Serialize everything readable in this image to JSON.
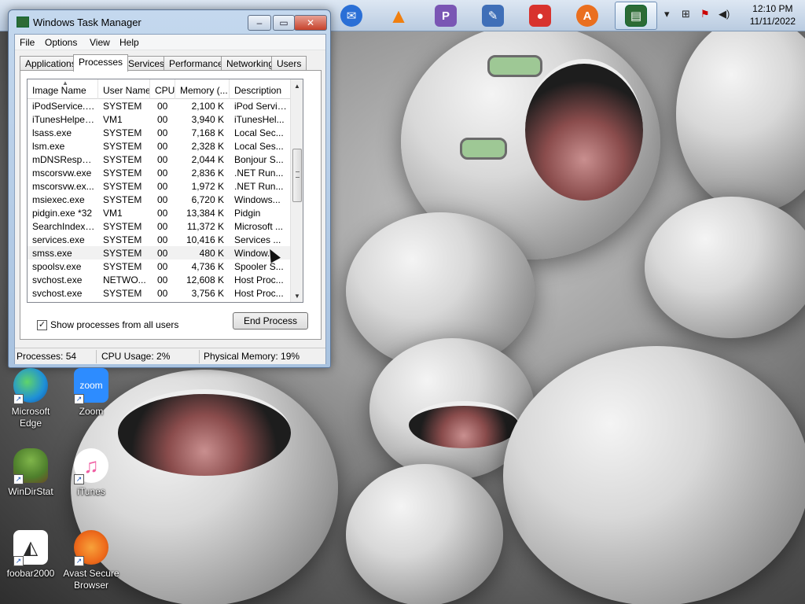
{
  "taskbar": {
    "pinned": [
      {
        "name": "thunderbird-icon",
        "color": "#2a6fd6"
      },
      {
        "name": "vlc-icon",
        "color": "#f07f0f"
      },
      {
        "name": "pidgin-icon",
        "color": "#7a56b4"
      },
      {
        "name": "paint-icon",
        "color": "#3f6fb8"
      },
      {
        "name": "recorder-icon",
        "color": "#d8332e"
      },
      {
        "name": "avast-browser-icon",
        "color": "#ea6f1f"
      },
      {
        "name": "task-manager-icon",
        "color": "#2d6b35"
      }
    ],
    "clock": {
      "time": "12:10 PM",
      "date": "11/11/2022"
    }
  },
  "window": {
    "title": "Windows Task Manager",
    "buttons": {
      "minimize": "–",
      "maximize": "▭",
      "close": "✕"
    },
    "menu": [
      "File",
      "Options",
      "View",
      "Help"
    ],
    "tabs": [
      "Applications",
      "Processes",
      "Services",
      "Performance",
      "Networking",
      "Users"
    ],
    "active_tab": "Processes",
    "columns": [
      "Image Name",
      "User Name",
      "CPU",
      "Memory (...",
      "Description"
    ],
    "processes": [
      {
        "name": "iPodService.exe",
        "user": "SYSTEM",
        "cpu": "00",
        "mem": "2,100 K",
        "desc": "iPod Service"
      },
      {
        "name": "iTunesHelper....",
        "user": "VM1",
        "cpu": "00",
        "mem": "3,940 K",
        "desc": "iTunesHel..."
      },
      {
        "name": "lsass.exe",
        "user": "SYSTEM",
        "cpu": "00",
        "mem": "7,168 K",
        "desc": "Local Sec..."
      },
      {
        "name": "lsm.exe",
        "user": "SYSTEM",
        "cpu": "00",
        "mem": "2,328 K",
        "desc": "Local Ses..."
      },
      {
        "name": "mDNSRespon...",
        "user": "SYSTEM",
        "cpu": "00",
        "mem": "2,044 K",
        "desc": "Bonjour S..."
      },
      {
        "name": "mscorsvw.exe",
        "user": "SYSTEM",
        "cpu": "00",
        "mem": "2,836 K",
        "desc": ".NET Run..."
      },
      {
        "name": "mscorsvw.ex...",
        "user": "SYSTEM",
        "cpu": "00",
        "mem": "1,972 K",
        "desc": ".NET Run..."
      },
      {
        "name": "msiexec.exe",
        "user": "SYSTEM",
        "cpu": "00",
        "mem": "6,720 K",
        "desc": "Windows..."
      },
      {
        "name": "pidgin.exe *32",
        "user": "VM1",
        "cpu": "00",
        "mem": "13,384 K",
        "desc": "Pidgin"
      },
      {
        "name": "SearchIndexe...",
        "user": "SYSTEM",
        "cpu": "00",
        "mem": "11,372 K",
        "desc": "Microsoft ..."
      },
      {
        "name": "services.exe",
        "user": "SYSTEM",
        "cpu": "00",
        "mem": "10,416 K",
        "desc": "Services ..."
      },
      {
        "name": "smss.exe",
        "user": "SYSTEM",
        "cpu": "00",
        "mem": "480 K",
        "desc": "Window...",
        "selected": true
      },
      {
        "name": "spoolsv.exe",
        "user": "SYSTEM",
        "cpu": "00",
        "mem": "4,736 K",
        "desc": "Spooler S..."
      },
      {
        "name": "svchost.exe",
        "user": "NETWO...",
        "cpu": "00",
        "mem": "12,608 K",
        "desc": "Host Proc..."
      },
      {
        "name": "svchost.exe",
        "user": "SYSTEM",
        "cpu": "00",
        "mem": "3,756 K",
        "desc": "Host Proc..."
      }
    ],
    "show_all_label": "Show processes from all users",
    "show_all_checked": true,
    "end_process_label": "End Process",
    "status": {
      "processes": "Processes: 54",
      "cpu": "CPU Usage: 2%",
      "memory": "Physical Memory: 19%"
    }
  },
  "desktop_icons": [
    {
      "label": "Microsoft Edge",
      "icon": "edge-icon",
      "color": "#1e8fd8"
    },
    {
      "label": "Zoom",
      "icon": "zoom-icon",
      "color": "#2d8cff",
      "text": "zoom"
    },
    {
      "label": "WinDirStat",
      "icon": "windirstat-icon",
      "color": "#4e7f2c"
    },
    {
      "label": "iTunes",
      "icon": "itunes-icon",
      "color": "#f05fa3"
    },
    {
      "label": "foobar2000",
      "icon": "foobar-icon",
      "color": "#2b2b2b"
    },
    {
      "label": "Avast Secure Browser",
      "icon": "avast-icon",
      "color": "#ee6a1b"
    }
  ]
}
